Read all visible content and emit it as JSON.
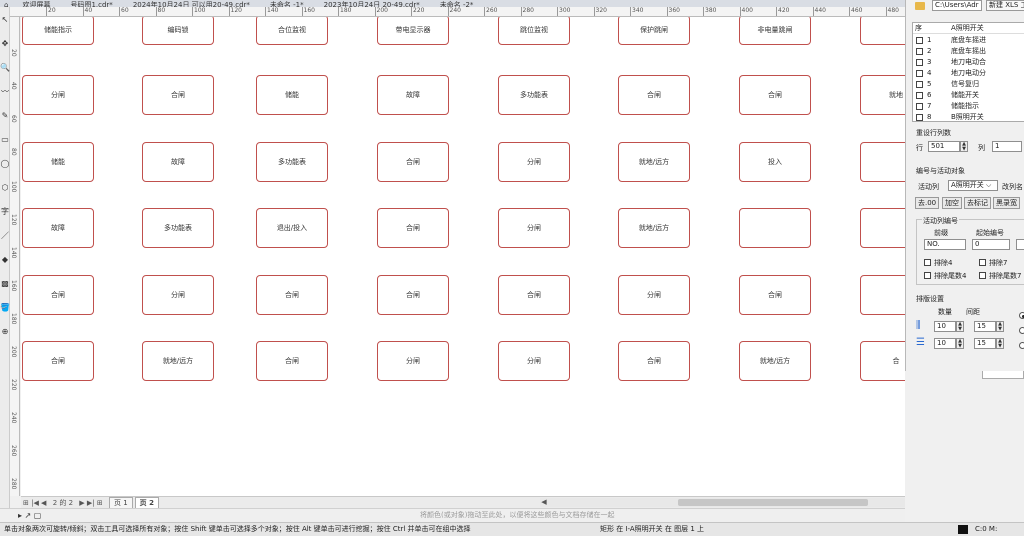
{
  "tabs": [
    "欢迎屏幕",
    "号码图1.cdr*",
    "2024年10月24日 可以用20-49.cdr*",
    "未命名 -1*",
    "2023年10月24日 20-49.cdr*",
    "未命名 -2*"
  ],
  "ruler_h": [
    "20",
    "40",
    "60",
    "80",
    "100",
    "120",
    "140",
    "160",
    "180",
    "200",
    "220",
    "240",
    "260",
    "280",
    "300",
    "320",
    "340",
    "360",
    "380",
    "400",
    "420",
    "440",
    "460",
    "480"
  ],
  "ruler_v": [
    "20",
    "40",
    "60",
    "80",
    "100",
    "120",
    "140",
    "160",
    "180",
    "200",
    "220",
    "240",
    "260",
    "280"
  ],
  "toolbox": [
    "↖",
    "✥",
    "🔍",
    "〰",
    "✎",
    "▭",
    "◯",
    "⬡",
    "字",
    "／",
    "◆",
    "▩",
    "🪣",
    "⊕"
  ],
  "grid": {
    "columns": 8,
    "rows": [
      [
        "储能指示",
        "编码锁",
        "合位监视",
        "带电显示器",
        "跳位监视",
        "保护跳闸",
        "非电量跳闸",
        ""
      ],
      [
        "分闸",
        "合闸",
        "储能",
        "故障",
        "多功能表",
        "合闸",
        "合闸",
        "就地"
      ],
      [
        "储能",
        "故障",
        "多功能表",
        "合闸",
        "分闸",
        "就地/远方",
        "投入",
        ""
      ],
      [
        "故障",
        "多功能表",
        "退出/投入",
        "合闸",
        "分闸",
        "就地/远方",
        "",
        ""
      ],
      [
        "合闸",
        "分闸",
        "合闸",
        "合闸",
        "合闸",
        "分闸",
        "合闸",
        ""
      ],
      [
        "合闸",
        "就地/远方",
        "合闸",
        "分闸",
        "分闸",
        "合闸",
        "就地/远方",
        "合"
      ]
    ]
  },
  "pagebar": {
    "nav": "⊞ |◀ ◀",
    "position": "2 的 2",
    "nav_end": "▶ ▶| ⊞",
    "tabs": [
      "页 1",
      "页 2"
    ],
    "active": 1
  },
  "bottomrow": {
    "tools": "▸ ↗ ▢",
    "hint": "将颜色(或对象)拖动至此处，以便将这些颜色与文档存储在一起"
  },
  "status": {
    "message": "单击对象两次可旋转/倾斜；双击工具可选择所有对象；按住 Shift 键单击可选择多个对象；按住 Alt 键单击可进行挖掘；按住 Ctrl 并单击可在组中选择",
    "object": "矩形 在 I-A照明开关 在 图层 1 上",
    "color": "C:0 M:"
  },
  "panel": {
    "path": "C:\\Users\\Adr",
    "new_xls": "新建 XLS 工作表",
    "list_header": [
      "序",
      "A照明开关"
    ],
    "list": [
      {
        "num": "1",
        "name": "底盘车摇进"
      },
      {
        "num": "2",
        "name": "底盘车摇出"
      },
      {
        "num": "3",
        "name": "地刀电动合"
      },
      {
        "num": "4",
        "name": "地刀电动分"
      },
      {
        "num": "5",
        "name": "信号复归"
      },
      {
        "num": "6",
        "name": "储能开关"
      },
      {
        "num": "7",
        "name": "储能指示"
      },
      {
        "num": "8",
        "name": "B照明开关"
      }
    ],
    "reset_title": "重设行列数",
    "row_label": "行",
    "row_value": "501",
    "col_label": "列",
    "col_value": "1",
    "numbering_title": "编号与活动对象",
    "active_col_label": "活动列",
    "active_col_value": "A照明开关",
    "rename_label": "改列名",
    "btn_remove00": "去.00",
    "btn_add": "加空",
    "btn_unmark": "去标记",
    "btn_blackwide": "黑录宽",
    "active_numbering_title": "活动列编号",
    "prefix_label": "前缀",
    "start_label": "起始编号",
    "prefix_value": "NO.",
    "start_value": "0",
    "exclude4": "排除4",
    "exclude7": "排除7",
    "exclude_tail4": "排除尾数4",
    "exclude_tail7": "排除尾数7",
    "arrange_title": "排版设置",
    "count_label": "数量",
    "spacing_label": "间距",
    "h_count": "10",
    "h_spacing": "15",
    "v_count": "10",
    "v_spacing": "15"
  }
}
